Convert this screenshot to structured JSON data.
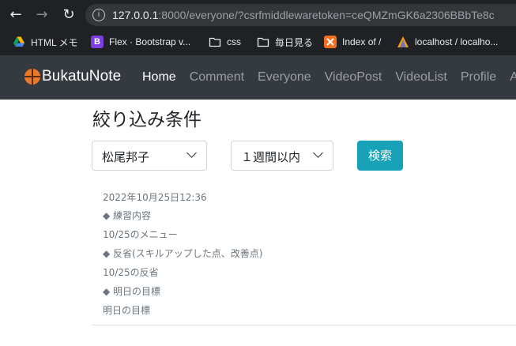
{
  "browser": {
    "url_host": "127.0.0.1",
    "url_rest": ":8000/everyone/?csrfmiddlewaretoken=ceQMZmGK6a2306BBbTe8c",
    "bookmarks": [
      {
        "label": "HTML メモ",
        "icon": "google-drive-icon"
      },
      {
        "label": "Flex · Bootstrap v...",
        "icon": "bootstrap-icon",
        "glyph": "B"
      },
      {
        "label": "css",
        "icon": "folder-icon"
      },
      {
        "label": "毎日見る",
        "icon": "folder-icon"
      },
      {
        "label": "Index of /",
        "icon": "xampp-icon"
      },
      {
        "label": "localhost / localho...",
        "icon": "phpmyadmin-icon"
      }
    ]
  },
  "navbar": {
    "brand": "BukatuNote",
    "links": [
      "Home",
      "Comment",
      "Everyone",
      "VideoPost",
      "VideoList",
      "Profile",
      "A"
    ],
    "active": "Home"
  },
  "filter": {
    "title": "絞り込み条件",
    "user_select": "松尾邦子",
    "period_select": "１週間以内",
    "search_button": "検索"
  },
  "post": {
    "timestamp": "2022年10月25日12:36",
    "practice_heading": "◆ 練習内容",
    "practice_body": "10/25のメニュー",
    "reflection_heading": "◆ 反省(スキルアップした点、改善点)",
    "reflection_body": "10/25の反省",
    "goal_heading": "◆ 明日の目標",
    "goal_body": "明日の目標"
  },
  "colors": {
    "navbar_bg": "#343a40",
    "search_button": "#17a2b8",
    "chrome_bg": "#202124"
  }
}
